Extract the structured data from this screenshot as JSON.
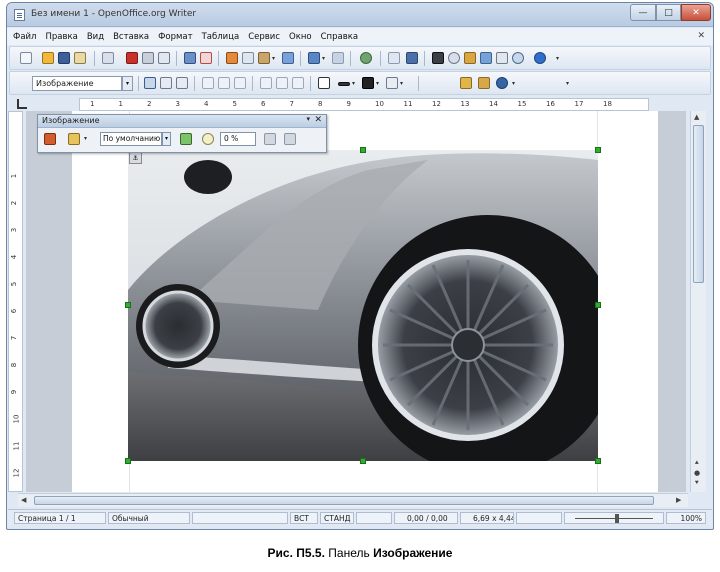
{
  "window": {
    "title": "Без имени 1 - OpenOffice.org Writer",
    "minimize_glyph": "—",
    "maximize_glyph": "□",
    "close_glyph": "✕"
  },
  "menubar": {
    "items": [
      "Файл",
      "Правка",
      "Вид",
      "Вставка",
      "Формат",
      "Таблица",
      "Сервис",
      "Окно",
      "Справка"
    ],
    "close_glyph": "✕"
  },
  "formatting": {
    "paragraph_style": "Изображение"
  },
  "ruler": {
    "ticks": [
      "1",
      "1",
      "2",
      "3",
      "4",
      "5",
      "6",
      "7",
      "8",
      "9",
      "10",
      "11",
      "12",
      "13",
      "14",
      "15",
      "16",
      "17",
      "18"
    ]
  },
  "vruler": {
    "ticks": [
      "1",
      "2",
      "3",
      "4",
      "5",
      "6",
      "7",
      "8",
      "9",
      "10",
      "11",
      "12"
    ]
  },
  "picture_toolbar": {
    "title": "Изображение",
    "menu_glyph": "▾",
    "close_glyph": "✕",
    "mode_value": "По умолчанию",
    "transparency_value": "0 %"
  },
  "statusbar": {
    "page": "Страница  1 / 1",
    "style": "Обычный",
    "insert_mode": "ВСТ",
    "selection_mode": "СТАНД",
    "position": "0,00 / 0,00",
    "size": "6,69 x 4,44",
    "zoom": "100%"
  },
  "caption": {
    "prefix": "Рис. П5.5.",
    "text": "Панель",
    "bold_word": "Изображение"
  },
  "colors": {
    "titlebar": "#c4d4e8",
    "selection_handle": "#2fae2f",
    "car_body": "#8f949a"
  }
}
